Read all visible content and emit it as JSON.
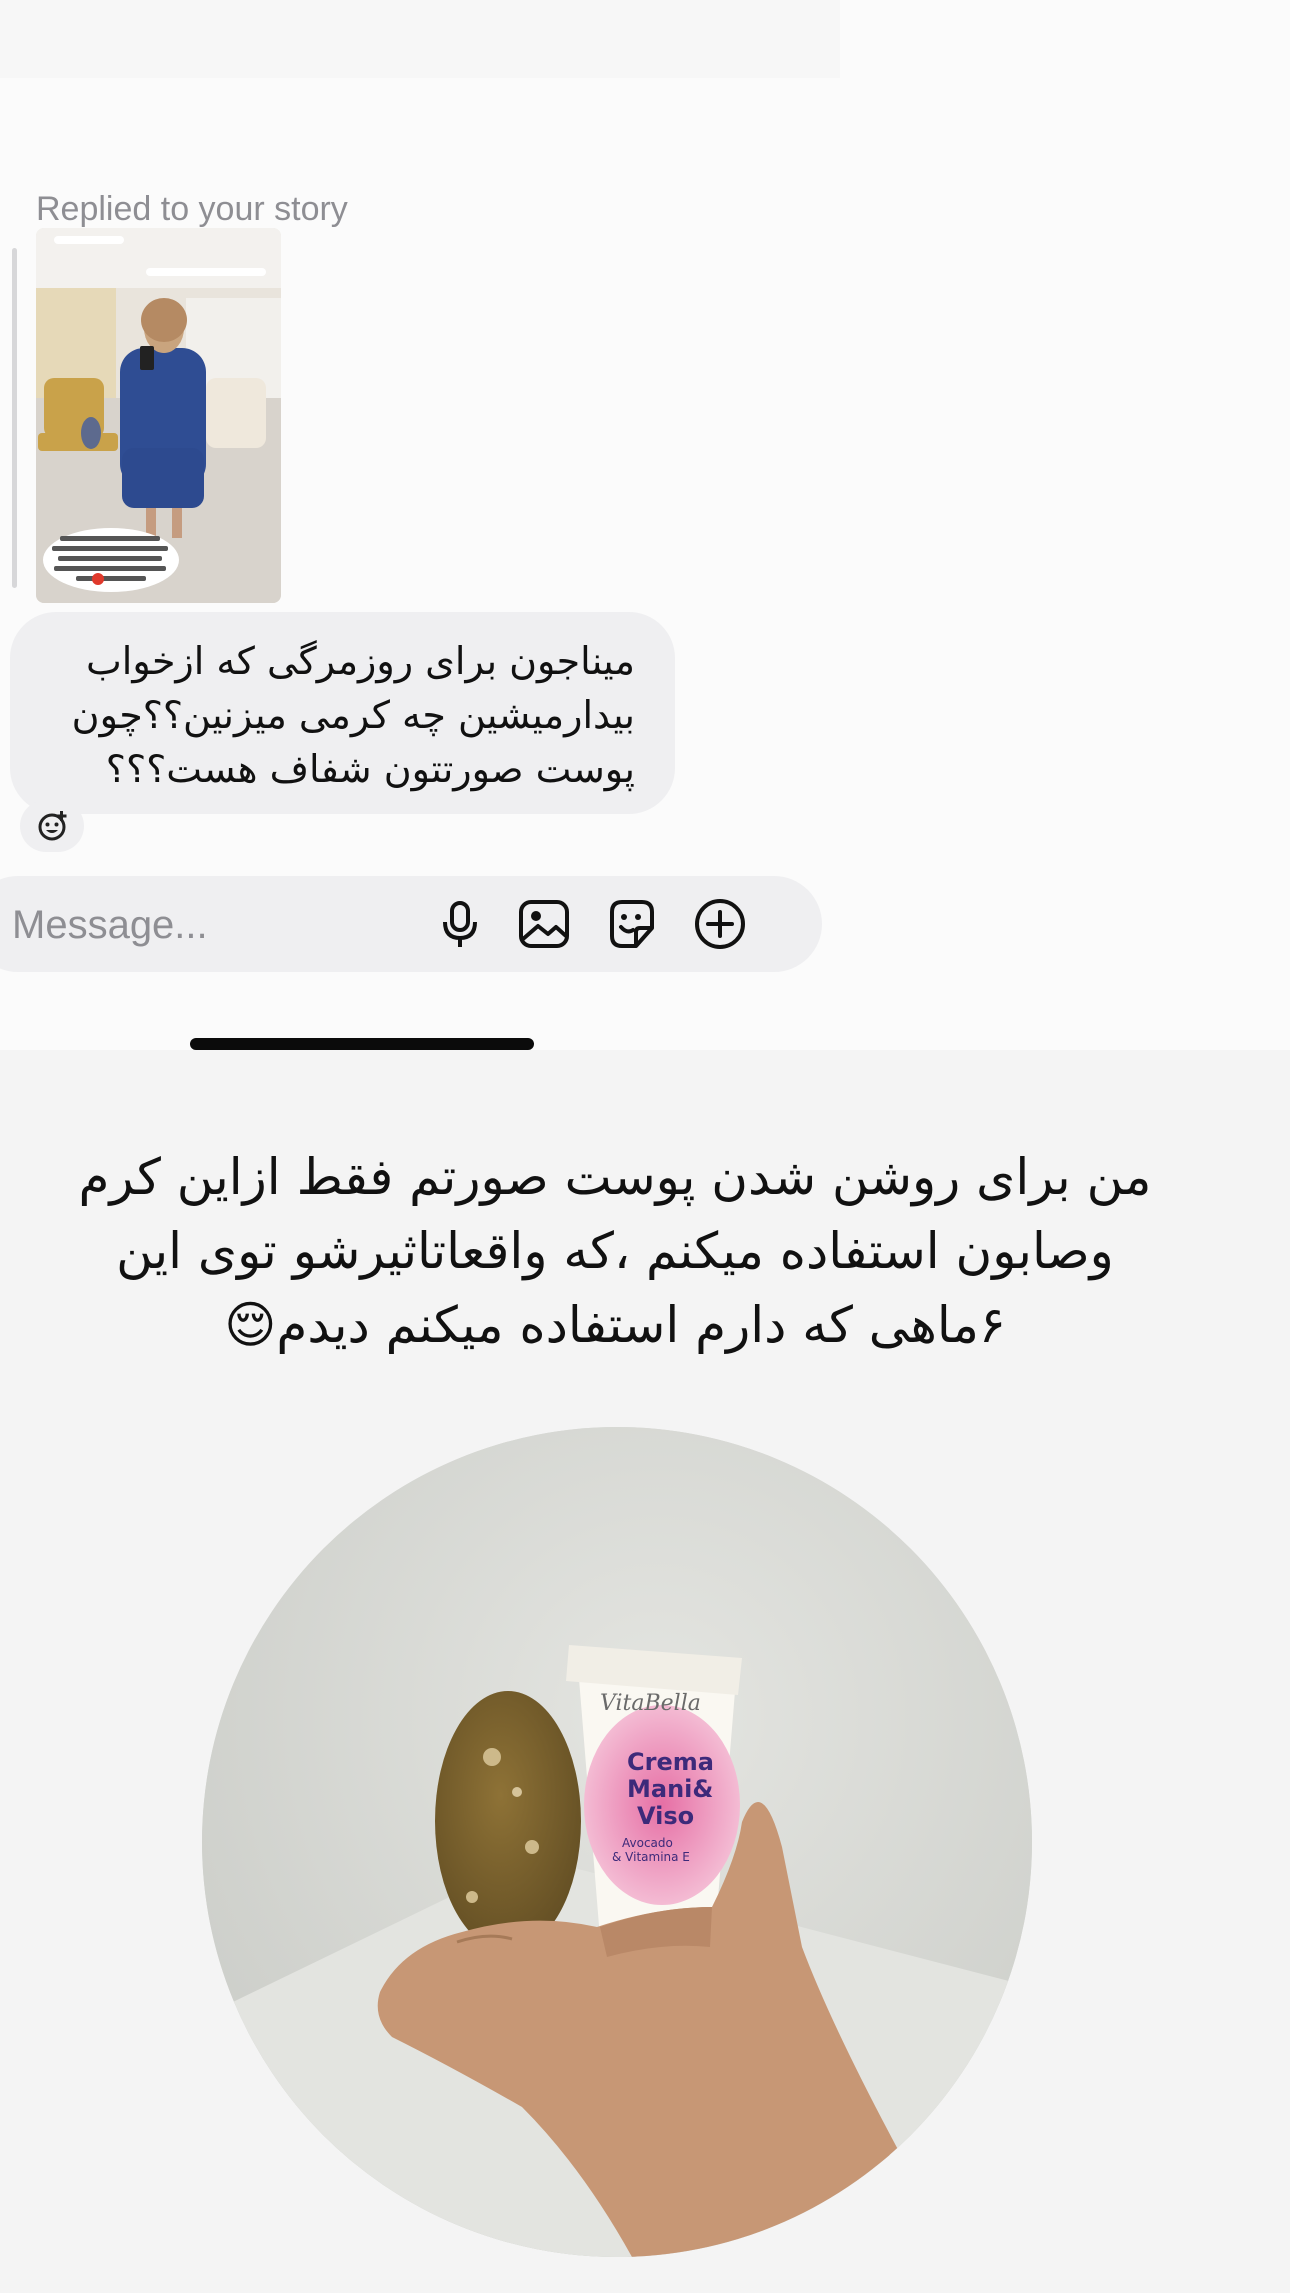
{
  "story_reply": {
    "label": "Replied to your story",
    "thumbnail_caption_lines": [
      "سلام مسخصنین بیعی 🧡",
      "امروز صبح زودتر بیدارشدم ،جلوه روزت رو",
      "گل گاوزبون نوشیدم ، فکرم رفت ،آرامم",
      "و پوست ام اینطوری شد ، خیلی",
      "شمارو هم یادم بود ❤"
    ]
  },
  "message": {
    "text": "میناجون برای روزمرگی که ازخواب بیدارمیشین چه کرمی میزنین؟؟چون پوست صورتتون شفاف هست؟؟؟",
    "reaction_icon": "add-reaction-icon"
  },
  "composer": {
    "placeholder": "Message...",
    "icons": [
      "microphone-icon",
      "gallery-icon",
      "sticker-icon",
      "plus-icon"
    ]
  },
  "caption": {
    "line1": "من برای روشن شدن پوست صورتم فقط ازاین کرم",
    "line2": "وصابون استفاده میکنم ،که واقعاتاثیرشو توی این",
    "line3": "۶ماهی که دارم استفاده میکنم دیدم😌"
  },
  "product": {
    "brand": "VitaBella",
    "name_line1": "Crema",
    "name_line2": "Mani&",
    "name_line3": "Viso",
    "sub1": "Avocado",
    "sub2": "& Vitamina E"
  },
  "colors": {
    "bubble": "#efeff1",
    "muted": "#8e8e93",
    "text": "#111111"
  }
}
